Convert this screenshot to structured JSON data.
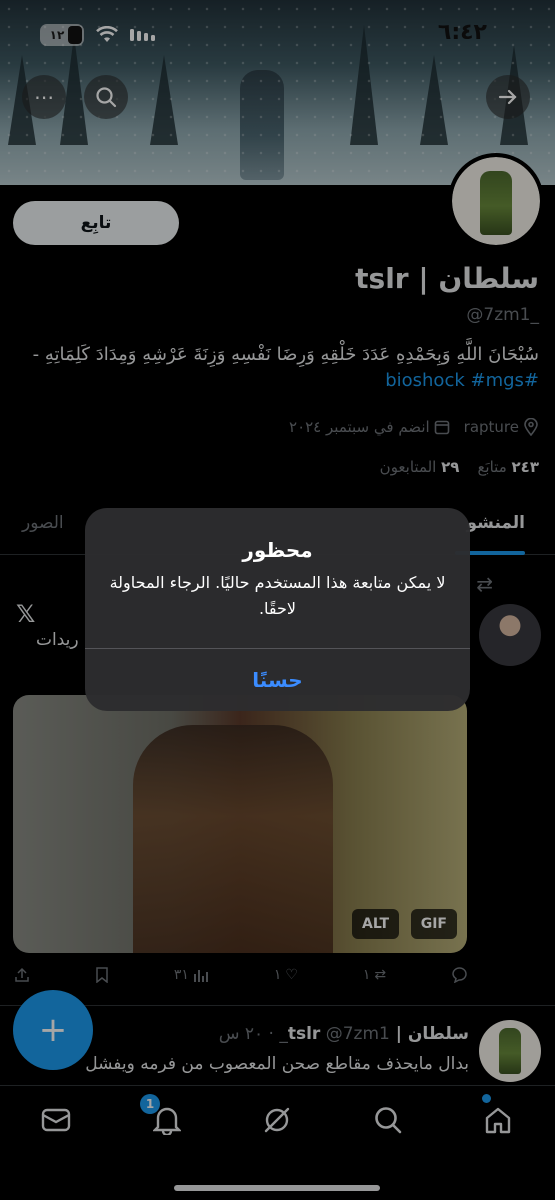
{
  "status_bar": {
    "time": "٦:٤٢",
    "battery": "١٢"
  },
  "profile": {
    "follow_label": "تابِع",
    "name": "سلطان | tslr",
    "handle": "@7zm1_",
    "bio": "سُبْحَانَ اللَّهِ وَبِحَمْدِهِ عَدَدَ خَلْقِهِ وَرِضَا نَفْسِهِ وَزِنَةَ عَرْشِهِ وَمِدَادَ كَلِمَاتِهِ - ",
    "bio_tags": "#bioshock #mgs",
    "location": "rapture",
    "joined": "انضم في سبتمبر ٢٠٢٤",
    "following_count": "٢٤٣",
    "following_label": "متابَع",
    "followers_count": "٢٩",
    "followers_label": "المتابعون"
  },
  "tabs": {
    "posts": "المنشو",
    "media": "الصور"
  },
  "pinned_tweet": {
    "snippet": "ريدات",
    "media_badges": {
      "alt": "ALT",
      "gif": "GIF"
    },
    "replies": "",
    "retweets": "١",
    "likes": "١",
    "views": "٣١"
  },
  "tweet2": {
    "name": "سلطان | tslr",
    "handle": "@7zm1_",
    "time": "٢٠ س",
    "text": "بدال مايحذف مقاطع صحن المعصوب من فرمه ويفشل"
  },
  "nav": {
    "notification_count": "1"
  },
  "alert": {
    "title": "محظور",
    "message": "لا يمكن متابعة هذا المستخدم حاليًا. الرجاء المحاولة لاحقًا.",
    "ok_label": "حسنًا"
  },
  "colors": {
    "accent": "#1d9bf0",
    "alert_button": "#3b8cff"
  }
}
